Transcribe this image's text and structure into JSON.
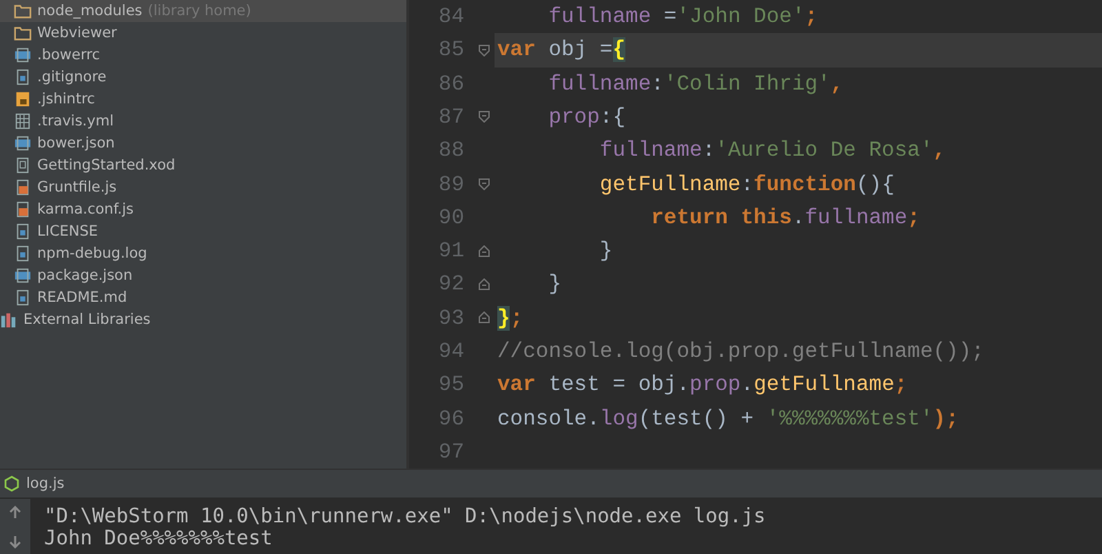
{
  "project_tree": {
    "items": [
      {
        "label": "node_modules",
        "note": "(library home)",
        "kind": "folder",
        "selected": true
      },
      {
        "label": "Webviewer",
        "kind": "folder",
        "selected": false
      },
      {
        "label": ".bowerrc",
        "kind": "json",
        "selected": false
      },
      {
        "label": ".gitignore",
        "kind": "text",
        "selected": false
      },
      {
        "label": ".jshintrc",
        "kind": "jsconfig",
        "selected": false
      },
      {
        "label": ".travis.yml",
        "kind": "yml",
        "selected": false
      },
      {
        "label": "bower.json",
        "kind": "json",
        "selected": false
      },
      {
        "label": "GettingStarted.xod",
        "kind": "unknown",
        "selected": false
      },
      {
        "label": "Gruntfile.js",
        "kind": "js",
        "selected": false
      },
      {
        "label": "karma.conf.js",
        "kind": "js",
        "selected": false
      },
      {
        "label": "LICENSE",
        "kind": "text",
        "selected": false
      },
      {
        "label": "npm-debug.log",
        "kind": "text",
        "selected": false
      },
      {
        "label": "package.json",
        "kind": "json",
        "selected": false
      },
      {
        "label": "README.md",
        "kind": "text",
        "selected": false
      },
      {
        "label": "External Libraries",
        "kind": "library",
        "selected": false
      }
    ]
  },
  "editor": {
    "lines": [
      {
        "number": "84",
        "kind": "plain",
        "current": false,
        "tokens": [
          {
            "text": "    fullname ",
            "kind": "prop"
          },
          {
            "text": "=",
            "kind": "plain"
          },
          {
            "text": "'John Doe'",
            "kind": "str"
          },
          {
            "text": ";",
            "kind": "kw"
          }
        ]
      },
      {
        "number": "85",
        "kind": "fold-start",
        "current": true,
        "tokens": [
          {
            "text": "var",
            "kind": "kw"
          },
          {
            "text": " obj =",
            "kind": "plain"
          },
          {
            "text": "{",
            "kind": "match"
          }
        ]
      },
      {
        "number": "86",
        "kind": "plain",
        "current": false,
        "tokens": [
          {
            "text": "    fullname",
            "kind": "prop"
          },
          {
            "text": ":",
            "kind": "plain"
          },
          {
            "text": "'Colin Ihrig'",
            "kind": "str"
          },
          {
            "text": ",",
            "kind": "kw"
          }
        ]
      },
      {
        "number": "87",
        "kind": "fold-start",
        "current": false,
        "tokens": [
          {
            "text": "    prop",
            "kind": "prop"
          },
          {
            "text": ":{",
            "kind": "plain"
          }
        ]
      },
      {
        "number": "88",
        "kind": "plain",
        "current": false,
        "tokens": [
          {
            "text": "        fullname",
            "kind": "prop"
          },
          {
            "text": ":",
            "kind": "plain"
          },
          {
            "text": "'Aurelio De Rosa'",
            "kind": "str"
          },
          {
            "text": ",",
            "kind": "kw"
          }
        ]
      },
      {
        "number": "89",
        "kind": "fold-start",
        "current": false,
        "tokens": [
          {
            "text": "        getFullname",
            "kind": "fn"
          },
          {
            "text": ":",
            "kind": "plain"
          },
          {
            "text": "function",
            "kind": "kw"
          },
          {
            "text": "(){",
            "kind": "plain"
          }
        ]
      },
      {
        "number": "90",
        "kind": "plain",
        "current": false,
        "tokens": [
          {
            "text": "            return this",
            "kind": "kw"
          },
          {
            "text": ".",
            "kind": "plain"
          },
          {
            "text": "fullname",
            "kind": "prop"
          },
          {
            "text": ";",
            "kind": "kw"
          }
        ]
      },
      {
        "number": "91",
        "kind": "fold-end",
        "current": false,
        "tokens": [
          {
            "text": "        }",
            "kind": "plain"
          }
        ]
      },
      {
        "number": "92",
        "kind": "fold-end",
        "current": false,
        "tokens": [
          {
            "text": "    }",
            "kind": "plain"
          }
        ]
      },
      {
        "number": "93",
        "kind": "fold-end",
        "current": false,
        "tokens": [
          {
            "text": "}",
            "kind": "match"
          },
          {
            "text": ";",
            "kind": "kw"
          }
        ]
      },
      {
        "number": "94",
        "kind": "plain",
        "current": false,
        "tokens": [
          {
            "text": "//console.log(obj.prop.getFullname());",
            "kind": "comment"
          }
        ]
      },
      {
        "number": "95",
        "kind": "plain",
        "current": false,
        "tokens": [
          {
            "text": "var",
            "kind": "kw"
          },
          {
            "text": " test = obj.",
            "kind": "plain"
          },
          {
            "text": "prop",
            "kind": "prop"
          },
          {
            "text": ".",
            "kind": "plain"
          },
          {
            "text": "getFullname",
            "kind": "fn"
          },
          {
            "text": ";",
            "kind": "kw"
          }
        ]
      },
      {
        "number": "96",
        "kind": "plain",
        "current": false,
        "tokens": [
          {
            "text": "console.",
            "kind": "plain"
          },
          {
            "text": "log",
            "kind": "prop"
          },
          {
            "text": "(test() + ",
            "kind": "plain"
          },
          {
            "text": "'%%%%%%%test'",
            "kind": "str"
          },
          {
            "text": ");",
            "kind": "kw"
          }
        ]
      },
      {
        "number": "97",
        "kind": "plain"
      }
    ]
  },
  "run_panel": {
    "tab": "log.js",
    "output": [
      "\"D:\\WebStorm 10.0\\bin\\runnerw.exe\" D:\\nodejs\\node.exe log.js",
      "John Doe%%%%%%%test"
    ]
  }
}
